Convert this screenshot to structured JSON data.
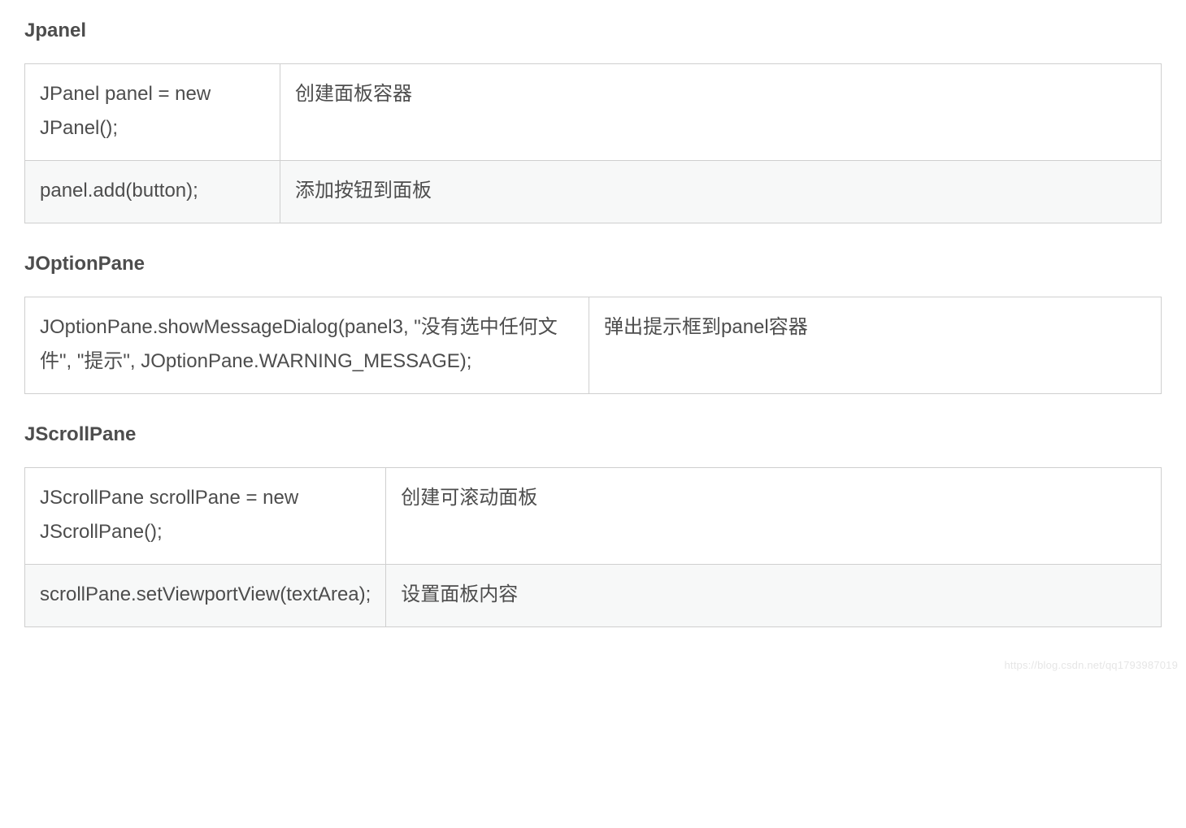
{
  "sections": [
    {
      "heading": "Jpanel",
      "rows": [
        {
          "code": "JPanel panel = new JPanel();",
          "desc": "创建面板容器"
        },
        {
          "code": "panel.add(button);",
          "desc": "添加按钮到面板"
        }
      ]
    },
    {
      "heading": "JOptionPane",
      "rows": [
        {
          "code": "JOptionPane.showMessageDialog(panel3, \"没有选中任何文件\", \"提示\", JOptionPane.WARNING_MESSAGE);",
          "desc": "弹出提示框到panel容器"
        }
      ]
    },
    {
      "heading": "JScrollPane",
      "rows": [
        {
          "code": "JScrollPane scrollPane = new JScrollPane();",
          "desc": "创建可滚动面板"
        },
        {
          "code": "scrollPane.setViewportView(textArea);",
          "desc": "设置面板内容"
        }
      ]
    }
  ],
  "watermark": "https://blog.csdn.net/qq1793987019"
}
